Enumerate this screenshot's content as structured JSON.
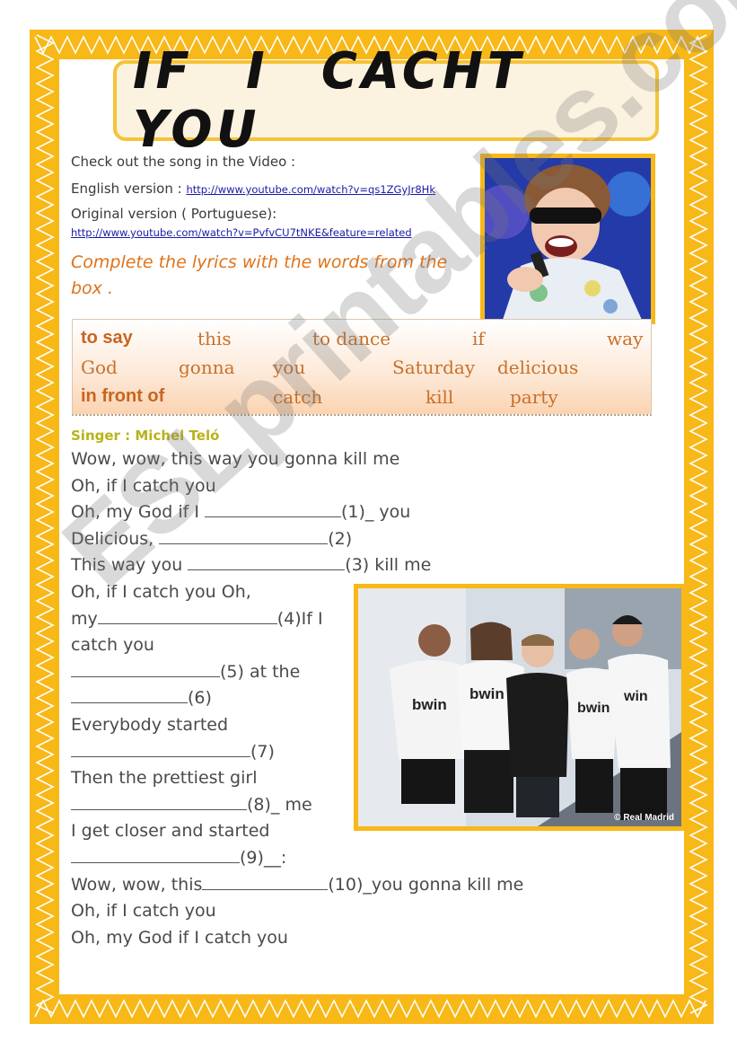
{
  "title": "IF I CACHT YOU",
  "intro": {
    "heading": "Check out the song in the Video :",
    "english_label": "English version : ",
    "english_link": "http://www.youtube.com/watch?v=qs1ZGyJr8Hk",
    "original_label": "Original version ( Portuguese):",
    "original_link": "http://www.youtube.com/watch?v=PvfvCU7tNKE&feature=related"
  },
  "instruction": "Complete the lyrics with the words from the box .",
  "word_box": [
    "to say",
    "this",
    "to dance",
    "if",
    "way",
    "God",
    "gonna",
    "you",
    "Saturday",
    "delicious",
    "in front of",
    "catch",
    "kill",
    "party"
  ],
  "singer": "Singer : Michel Teló",
  "lyrics": {
    "l1": "Wow, wow, this way you gonna kill me",
    "l2": "Oh, if I catch you",
    "l3a": "Oh, my God if I ",
    "l3b": "(1)_ you",
    "l4a": "Delicious, ",
    "l4b": "(2)",
    "l5a": "This way you ",
    "l5b": "(3) kill me",
    "l6": "Oh, if I catch you Oh,",
    "l7a": "my",
    "l7b": "(4)If I",
    "l8": "catch you",
    "l9b": "(5) at the",
    "l10b": "(6)",
    "l11": "Everybody started",
    "l12b": "(7)",
    "l13": "Then the prettiest girl",
    "l14b": "(8)_ me",
    "l15": "I get closer and started",
    "l16b": "(9)__:",
    "l17a": "Wow, wow, this",
    "l17b": "(10)_you gonna kill me",
    "l18": "Oh, if I catch you",
    "l19": "Oh, my God if I catch you"
  },
  "photo_1": {
    "alt": "singer-performing-photo"
  },
  "photo_2": {
    "alt": "singer-with-real-madrid-players-photo",
    "credit": "© Real Madrid"
  },
  "watermark": "ESLprintables.com",
  "colors": {
    "border": "#f7b818",
    "instruction": "#e0731a",
    "word_box_text": "#c8702a",
    "singer": "#b9b31a",
    "link": "#1a1aa6"
  }
}
